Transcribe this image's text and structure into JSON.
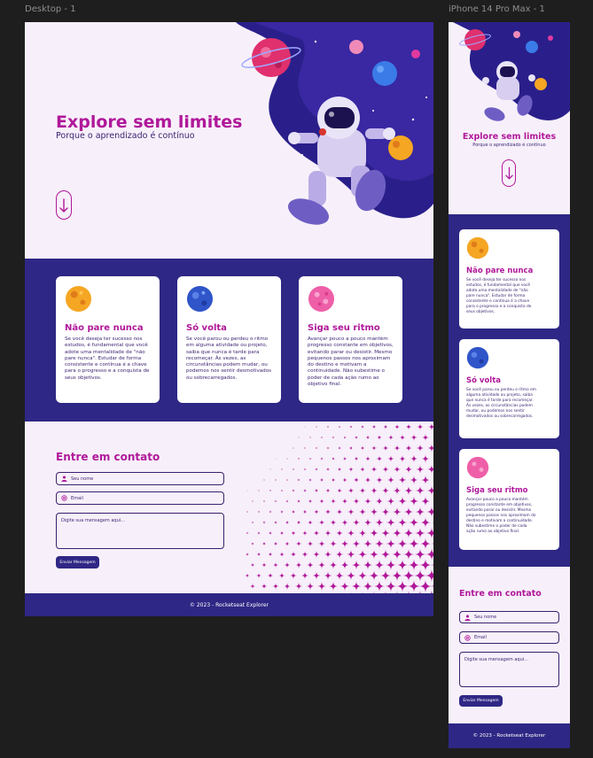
{
  "frames": {
    "desktop_label": "Desktop - 1",
    "mobile_label": "iPhone 14 Pro Max - 1"
  },
  "hero": {
    "title": "Explore sem limites",
    "subtitle": "Porque o aprendizado é contínuo",
    "scroll_icon": "arrow-down-icon"
  },
  "cards": [
    {
      "title": "Não pare nunca",
      "text": "Se você deseja ter sucesso nos estudos, é fundamental que você adote uma mentalidade de \"não pare nunca\". Estudar de forma consistente e contínua é a chave para o progresso e a conquista de seus objetivos.",
      "planet_color": "#f5a623"
    },
    {
      "title": "Só volta",
      "text": "Se você parou ou perdeu o ritmo em alguma atividade ou projeto, saiba que nunca é tarde para recomeçar. Às vezes, as circunstâncias podem mudar, ou podemos nos sentir desmotivados ou sobrecarregados.",
      "planet_color": "#2f55c9"
    },
    {
      "title": "Siga seu ritmo",
      "text": "Avançar pouco a pouco mantém progresso constante em objetivos, evitando parar ou desistir. Mesmo pequenos passos nos aproximam do destino e motivam a continuidade. Não subestime o poder de cada ação rumo ao objetivo final.",
      "planet_color": "#ee5fa8"
    }
  ],
  "contact": {
    "title": "Entre em contato",
    "name_placeholder": "Seu nome",
    "email_placeholder": "Email",
    "message_placeholder": "Digite sua mensagem aqui...",
    "send_label": "Enviar Mensagem"
  },
  "footer": {
    "text": "© 2023 - Rocketseat Explorer"
  },
  "colors": {
    "accent": "#b0189a",
    "navy": "#2f2785",
    "text": "#3a1f70",
    "background": "#f7f0fa"
  }
}
